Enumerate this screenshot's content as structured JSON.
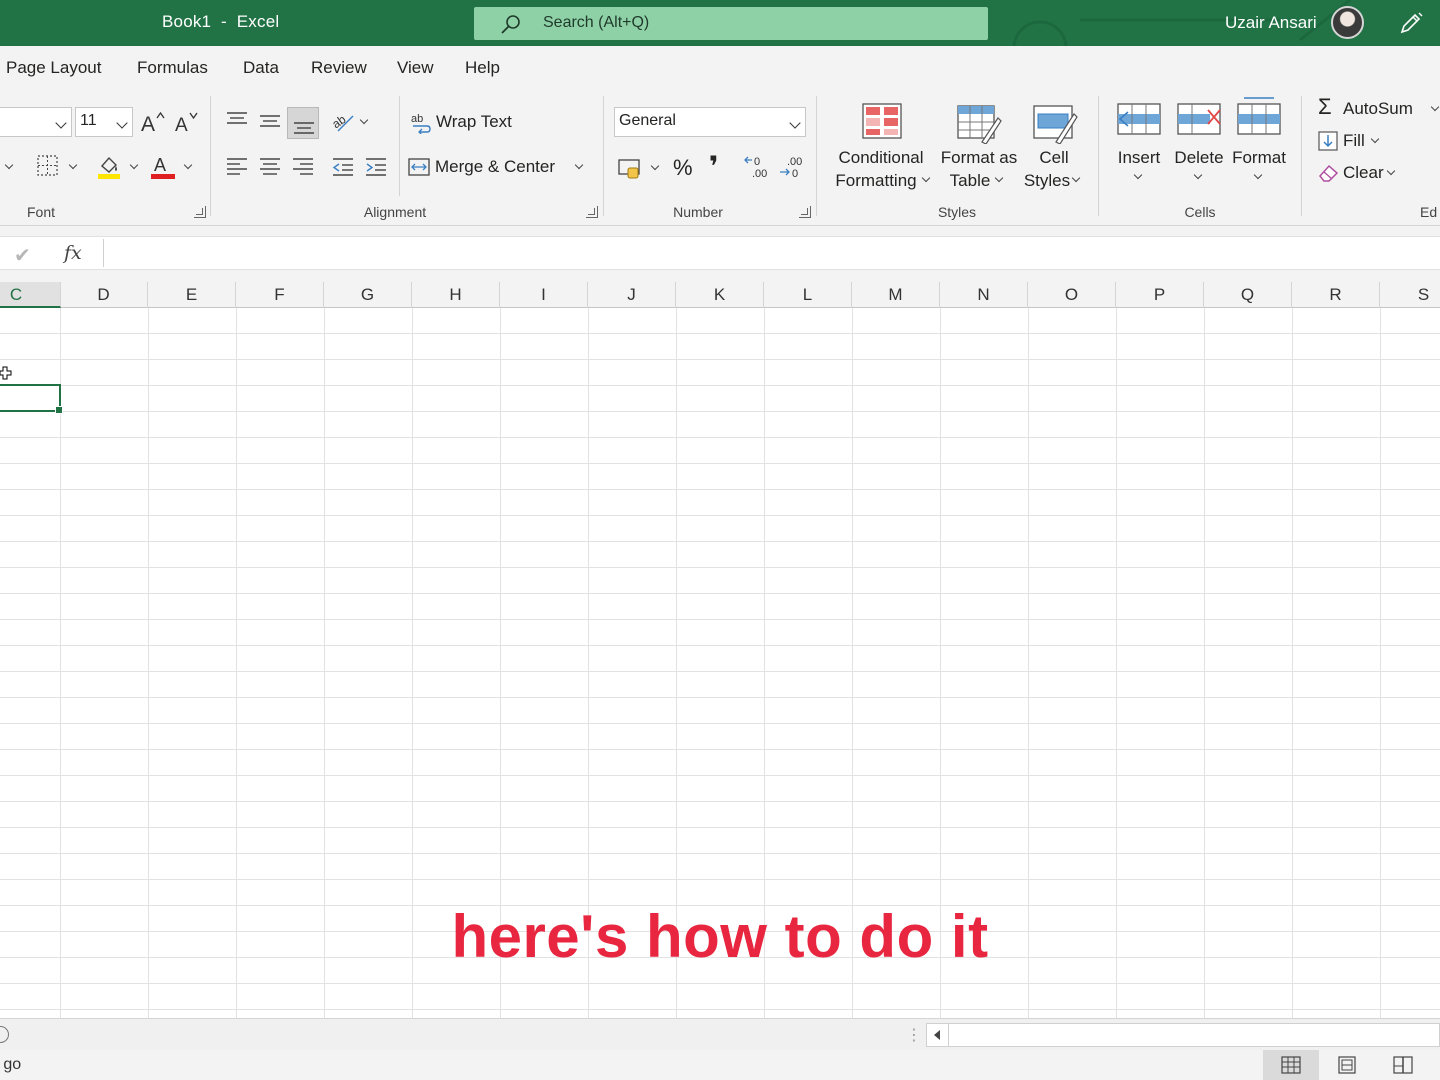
{
  "titlebar": {
    "doc_title": "Book1  -  Excel",
    "search_placeholder": "Search (Alt+Q)",
    "user_name": "Uzair Ansari",
    "bg_color": "#217346"
  },
  "menu": {
    "tabs": [
      "Page Layout",
      "Formulas",
      "Data",
      "Review",
      "View",
      "Help"
    ]
  },
  "ribbon": {
    "font": {
      "size_value": "11",
      "label": "Font"
    },
    "alignment": {
      "wrap_text": "Wrap Text",
      "merge_center": "Merge & Center",
      "label": "Alignment"
    },
    "number": {
      "format_value": "General",
      "percent": "%",
      "comma": "❜",
      "label": "Number"
    },
    "styles": {
      "conditional_line1": "Conditional",
      "conditional_line2": "Formatting",
      "format_table_line1": "Format as",
      "format_table_line2": "Table",
      "cell_styles_line1": "Cell",
      "cell_styles_line2": "Styles",
      "label": "Styles"
    },
    "cells": {
      "insert": "Insert",
      "delete": "Delete",
      "format": "Format",
      "label": "Cells"
    },
    "editing": {
      "autosum": "AutoSum",
      "fill": "Fill",
      "clear": "Clear",
      "label": "Ed"
    }
  },
  "formula_bar": {
    "fx_label": "fx",
    "check": "✔",
    "value": ""
  },
  "columns": [
    "C",
    "D",
    "E",
    "F",
    "G",
    "H",
    "I",
    "J",
    "K",
    "L",
    "M",
    "N",
    "O",
    "P",
    "Q",
    "R",
    "S"
  ],
  "selected_column": "C",
  "overlay_caption": "here's how to do it",
  "status": {
    "ready_text": "o go"
  },
  "accent_color": "#217346",
  "caption_color": "#e8263f"
}
